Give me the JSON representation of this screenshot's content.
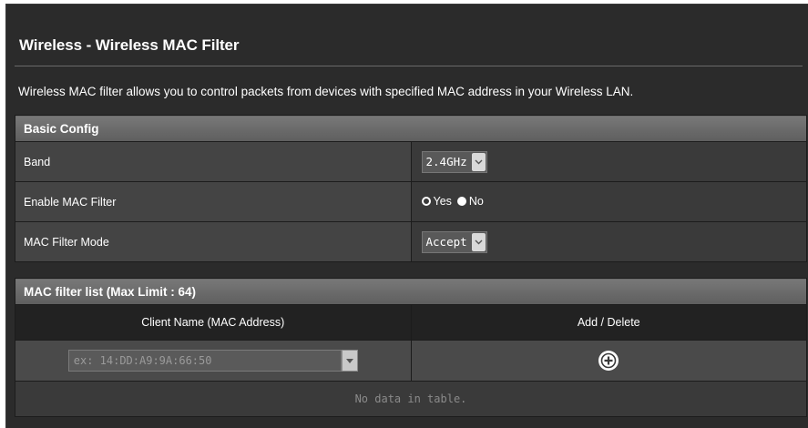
{
  "page": {
    "title": "Wireless - Wireless MAC Filter",
    "description": "Wireless MAC filter allows you to control packets from devices with specified MAC address in your Wireless LAN."
  },
  "basic_config": {
    "header": "Basic Config",
    "band": {
      "label": "Band",
      "value": "2.4GHz"
    },
    "enable_mac_filter": {
      "label": "Enable MAC Filter",
      "options": [
        "Yes",
        "No"
      ],
      "selected": "No"
    },
    "mac_filter_mode": {
      "label": "MAC Filter Mode",
      "value": "Accept"
    }
  },
  "mac_list": {
    "header": "MAC filter list (Max Limit : 64)",
    "columns": [
      "Client Name (MAC Address)",
      "Add / Delete"
    ],
    "input_placeholder": "ex: 14:DD:A9:9A:66:50",
    "empty_text": "No data in table."
  },
  "icons": {
    "add": "plus-circle-icon",
    "dropdown": "chevron-down-icon"
  },
  "colors": {
    "background": "#2b2b2b",
    "header_gradient_top": "#787878",
    "label_cell": "#444444",
    "value_cell": "#3a3a3a"
  }
}
